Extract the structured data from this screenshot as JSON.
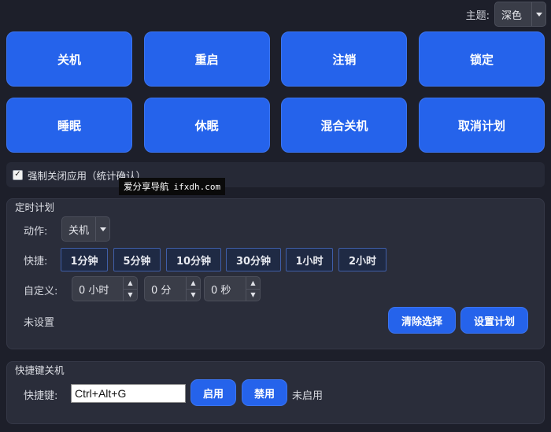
{
  "theme": {
    "label": "主题:",
    "selected": "深色"
  },
  "actions": [
    {
      "label": "关机",
      "name": "shutdown-button"
    },
    {
      "label": "重启",
      "name": "restart-button"
    },
    {
      "label": "注销",
      "name": "logoff-button"
    },
    {
      "label": "锁定",
      "name": "lock-button"
    },
    {
      "label": "睡眠",
      "name": "sleep-button"
    },
    {
      "label": "休眠",
      "name": "hibernate-button"
    },
    {
      "label": "混合关机",
      "name": "hybrid-shutdown-button"
    },
    {
      "label": "取消计划",
      "name": "cancel-plan-button"
    }
  ],
  "force_close": {
    "checked": true,
    "check_mark": "✓",
    "label": "强制关闭应用（统计确认）"
  },
  "watermark": {
    "text": "爱分享导航",
    "url": "ifxdh.com"
  },
  "schedule": {
    "title": "定时计划",
    "action_label": "动作:",
    "action_selected": "关机",
    "quick_label": "快捷:",
    "quick_options": [
      "1分钟",
      "5分钟",
      "10分钟",
      "30分钟",
      "1小时",
      "2小时"
    ],
    "custom_label": "自定义:",
    "hours": "0 小时",
    "minutes": "0 分",
    "seconds": "0 秒",
    "spin_up": "▲",
    "spin_down": "▼",
    "status": "未设置",
    "clear_label": "清除选择",
    "set_label": "设置计划"
  },
  "hotkey": {
    "title": "快捷键关机",
    "key_label": "快捷键:",
    "value": "Ctrl+Alt+G",
    "enable_label": "启用",
    "disable_label": "禁用",
    "status": "未启用"
  },
  "colors": {
    "background": "#1d1f2a",
    "accent": "#2563eb",
    "panel": "#2a2d3a"
  }
}
